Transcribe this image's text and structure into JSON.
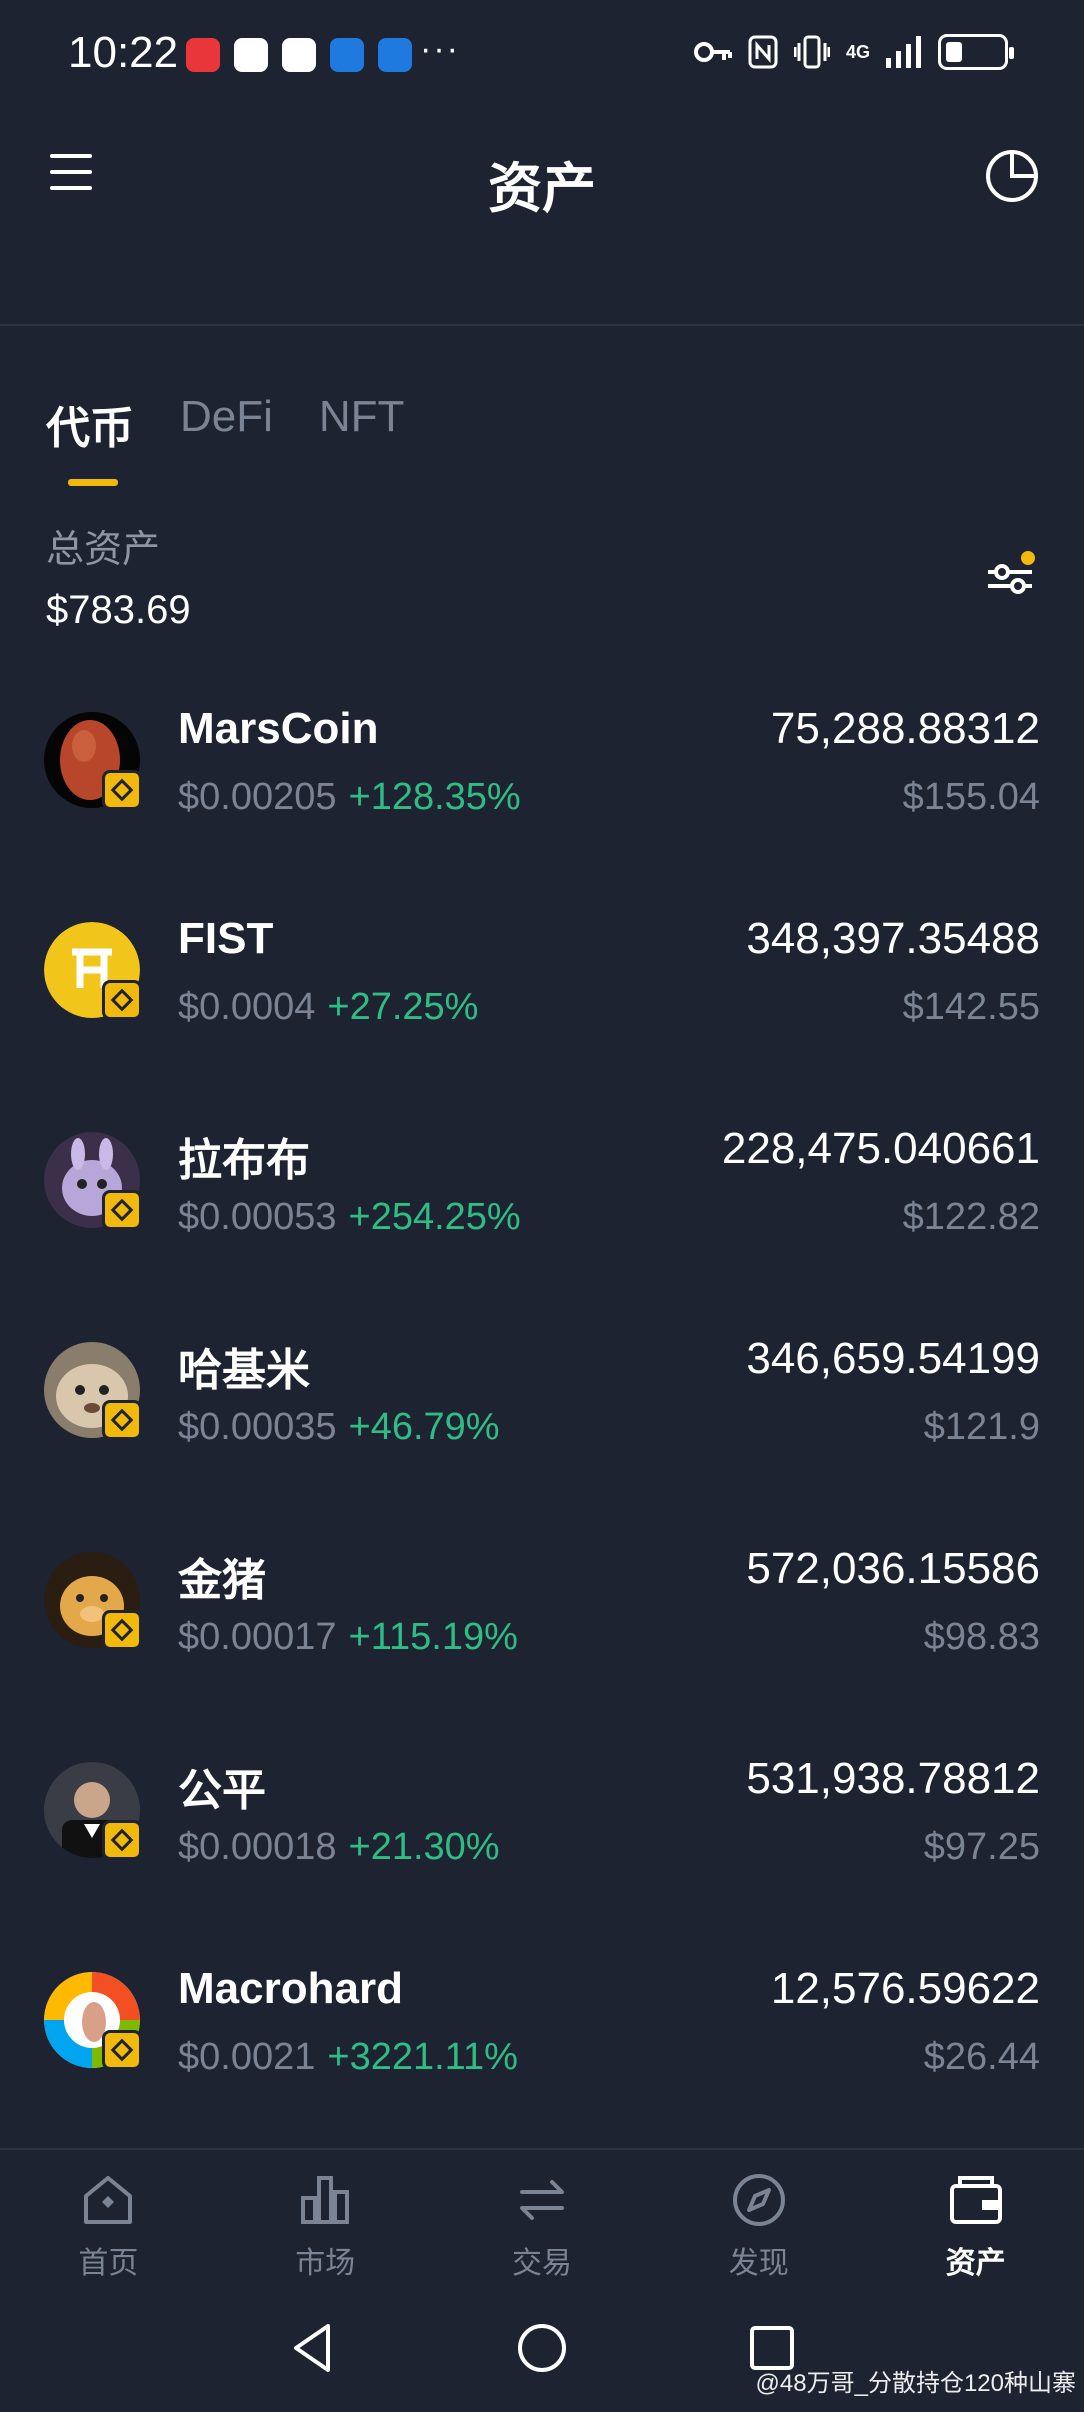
{
  "status_bar": {
    "time": "10:22",
    "more": "···",
    "network": "4G",
    "app_icon_colors": [
      "#e8363b",
      "#ffffff",
      "#ffffff",
      "#1f7ae0",
      "#1f7ae0"
    ]
  },
  "header": {
    "title": "资产"
  },
  "tabs": [
    {
      "label": "代币",
      "active": true
    },
    {
      "label": "DeFi",
      "active": false
    },
    {
      "label": "NFT",
      "active": false
    }
  ],
  "summary": {
    "label": "总资产",
    "value": "$783.69"
  },
  "assets": [
    {
      "name": "MarsCoin",
      "price": "$0.00205",
      "change": "+128.35%",
      "amount": "75,288.88312",
      "value": "$155.04"
    },
    {
      "name": "FIST",
      "price": "$0.0004",
      "change": "+27.25%",
      "amount": "348,397.35488",
      "value": "$142.55"
    },
    {
      "name": "拉布布",
      "price": "$0.00053",
      "change": "+254.25%",
      "amount": "228,475.040661",
      "value": "$122.82"
    },
    {
      "name": "哈基米",
      "price": "$0.00035",
      "change": "+46.79%",
      "amount": "346,659.54199",
      "value": "$121.9"
    },
    {
      "name": "金猪",
      "price": "$0.00017",
      "change": "+115.19%",
      "amount": "572,036.15586",
      "value": "$98.83"
    },
    {
      "name": "公平",
      "price": "$0.00018",
      "change": "+21.30%",
      "amount": "531,938.78812",
      "value": "$97.25"
    },
    {
      "name": "Macrohard",
      "price": "$0.0021",
      "change": "+3221.11%",
      "amount": "12,576.59622",
      "value": "$26.44"
    }
  ],
  "bottom_nav": [
    {
      "label": "首页",
      "icon": "home-icon",
      "active": false
    },
    {
      "label": "市场",
      "icon": "market-icon",
      "active": false
    },
    {
      "label": "交易",
      "icon": "trade-icon",
      "active": false
    },
    {
      "label": "发现",
      "icon": "discover-icon",
      "active": false
    },
    {
      "label": "资产",
      "icon": "wallet-icon",
      "active": true
    }
  ],
  "watermark": "@48万哥_分散持仓120种山寨",
  "colors": {
    "background": "#1d2330",
    "accent": "#f0b90b",
    "positive": "#2ebd85",
    "muted": "#7b8494"
  }
}
